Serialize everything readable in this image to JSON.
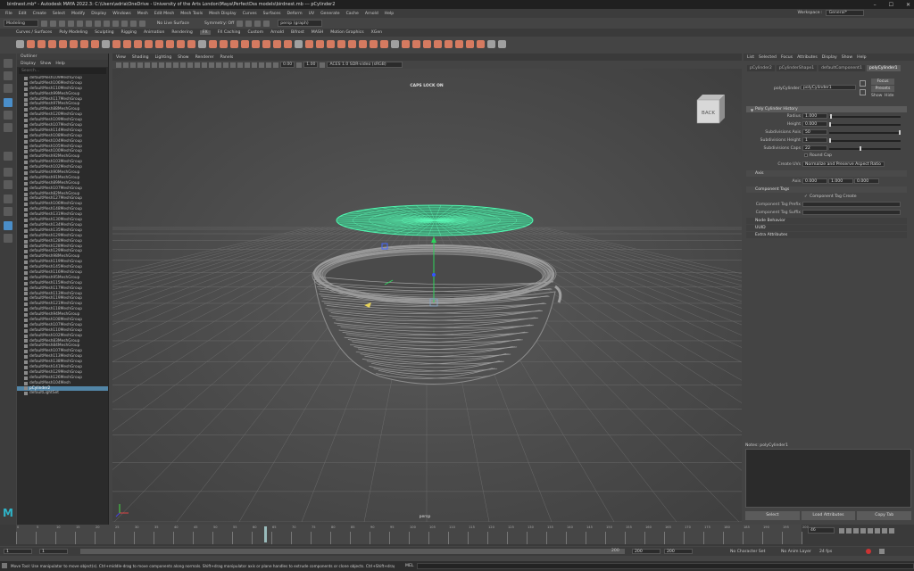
{
  "window": {
    "title": "birdnest.mb* - Autodesk MAYA 2022.3: C:\\Users\\adria\\OneDrive - University of the Arts London\\Maya\\PerfectDss models\\birdnest.mb  ---  pCylinder2",
    "minimize": "–",
    "maximize": "☐",
    "close": "✕"
  },
  "menubar": [
    "File",
    "Edit",
    "Create",
    "Select",
    "Modify",
    "Display",
    "Windows",
    "Mesh",
    "Edit Mesh",
    "Mesh Tools",
    "Mesh Display",
    "Curves",
    "Surfaces",
    "Deform",
    "UV",
    "Generate",
    "Cache",
    "Arnold",
    "Help"
  ],
  "workspace": {
    "label": "Workspace :",
    "value": "General*"
  },
  "statusline": {
    "mode": "Modeling",
    "live_surface": "No Live Surface",
    "symmetry": "Symmetry: Off",
    "camera": "persp (graph)"
  },
  "shelf_tabs": [
    "Curves / Surfaces",
    "Poly Modeling",
    "Sculpting",
    "Rigging",
    "Animation",
    "Rendering",
    "FX",
    "FX Caching",
    "Custom",
    "Arnold",
    "Bifrost",
    "MASH",
    "Motion Graphics",
    "XGen"
  ],
  "shelf_active_tab": "FX",
  "outliner": {
    "title": "Outliner",
    "menu": [
      "Display",
      "Show",
      "Help"
    ],
    "search": "Search...",
    "items": [
      "defaultMesh109MeshGroup",
      "defaultMesh106MeshGroup",
      "defaultMesh110MeshGroup",
      "defaultMesh99MeshGroup",
      "defaultMesh117MeshGroup",
      "defaultMesh97MeshGroup",
      "defaultMesh88MeshGroup",
      "defaultMesh120MeshGroup",
      "defaultMesh109MeshGroup",
      "defaultMesh107MeshGroup",
      "defaultMesh114MeshGroup",
      "defaultMesh108MeshGroup",
      "defaultMesh104MeshGroup",
      "defaultMesh105MeshGroup",
      "defaultMesh100MeshGroup",
      "defaultMesh92MeshGroup",
      "defaultMesh103MeshGroup",
      "defaultMesh102MeshGroup",
      "defaultMesh90MeshGroup",
      "defaultMesh91MeshGroup",
      "defaultMesh89MeshGroup",
      "defaultMesh107MeshGroup",
      "defaultMesh82MeshGroup",
      "defaultMesh127MeshGroup",
      "defaultMesh106MeshGroup",
      "defaultMesh148MeshGroup",
      "defaultMesh131MeshGroup",
      "defaultMesh130MeshGroup",
      "defaultMesh134MeshGroup",
      "defaultMesh135MeshGroup",
      "defaultMesh129MeshGroup",
      "defaultMesh128MeshGroup",
      "defaultMesh128MeshGroup",
      "defaultMesh129MeshGroup",
      "defaultMesh98MeshGroup",
      "defaultMesh119MeshGroup",
      "defaultMesh145MeshGroup",
      "defaultMesh116MeshGroup",
      "defaultMesh95MeshGroup",
      "defaultMesh115MeshGroup",
      "defaultMesh117MeshGroup",
      "defaultMesh113MeshGroup",
      "defaultMesh119MeshGroup",
      "defaultMesh121MeshGroup",
      "defaultMesh118MeshGroup",
      "defaultMesh94MeshGroup",
      "defaultMesh108MeshGroup",
      "defaultMesh107MeshGroup",
      "defaultMesh110MeshGroup",
      "defaultMesh102MeshGroup",
      "defaultMesh83MeshGroup",
      "defaultMesh84MeshGroup",
      "defaultMesh107MeshGroup",
      "defaultMesh113MeshGroup",
      "defaultMesh138MeshGroup",
      "defaultMesh141MeshGroup",
      "defaultMesh129MeshGroup",
      "defaultMesh126MeshGroup",
      "defaultMesh104Mesh",
      "pCylinder2",
      "defaultLightSet"
    ],
    "selected": "pCylinder2"
  },
  "viewport": {
    "menu": [
      "View",
      "Shading",
      "Lighting",
      "Show",
      "Renderer",
      "Panels"
    ],
    "exposure": "0.00",
    "gamma": "1.00",
    "colorspace": "ACES 1.0 SDR-video (sRGB)",
    "caps_lock": "CAPS LOCK ON",
    "camera_label": "persp",
    "viewcube_face": "BACK"
  },
  "attribute_editor": {
    "menu": [
      "List",
      "Selected",
      "Focus",
      "Attributes",
      "Display",
      "Show",
      "Help"
    ],
    "tabs": [
      "pCylinder2",
      "pCylinderShape1",
      "defaultComponent1",
      "polyCylinder1"
    ],
    "active_tab": "polyCylinder1",
    "node_label": "polyCylinder:",
    "node_value": "polyCylinder1",
    "focus_btn": "Focus",
    "presets_btn": "Presets",
    "show_btn": "Show",
    "hide_btn": "Hide",
    "sec_history": "Poly Cylinder History",
    "radius_label": "Radius",
    "radius": "1.000",
    "height_label": "Height",
    "height": "0.000",
    "subax_label": "Subdivisions Axis",
    "subax": "50",
    "subh_label": "Subdivisions Height",
    "subh": "1",
    "subcaps_label": "Subdivisions Caps",
    "subcaps": "22",
    "roundcap": "Round Cap",
    "uvs_label": "Create UVs",
    "uvs": "Normalize and Preserve Aspect Ratio",
    "sec_axis": "Axis",
    "axis_label": "Axis",
    "axis_x": "0.000",
    "axis_y": "1.000",
    "axis_z": "0.000",
    "sec_tags": "Component Tags",
    "tag_create": "Component Tag Create",
    "tag_prefix_label": "Component Tag Prefix",
    "tag_suffix_label": "Component Tag Suffix",
    "sec_node": "Node Behavior",
    "sec_uuid": "UUID",
    "sec_extra": "Extra Attributes",
    "notes_label": "Notes:  polyCylinder1",
    "btn_select": "Select",
    "btn_load": "Load Attributes",
    "btn_copy": "Copy Tab"
  },
  "timeline": {
    "ticks": [
      "0",
      "5",
      "10",
      "15",
      "20",
      "25",
      "30",
      "35",
      "40",
      "45",
      "50",
      "55",
      "60",
      "65",
      "70",
      "75",
      "80",
      "85",
      "90",
      "95",
      "100",
      "105",
      "110",
      "115",
      "120",
      "125",
      "130",
      "135",
      "140",
      "145",
      "150",
      "155",
      "160",
      "165",
      "170",
      "175",
      "180",
      "185",
      "190",
      "195",
      "200"
    ],
    "current_frame": "46"
  },
  "range": {
    "start": "1",
    "start2": "1",
    "end": "200",
    "end2": "200",
    "end3": "200",
    "character_set": "No Character Set",
    "anim_layer": "No Anim Layer",
    "fps": "24 fps"
  },
  "helpline": {
    "text": "Move Tool: Use manipulator to move object(s). Ctrl+middle-drag to move components along normals. Shift+drag manipulator axis or plane handles to extrude components or clone objects. Ctrl+Shift+drag to constrain movement to a con",
    "mel": "MEL"
  }
}
